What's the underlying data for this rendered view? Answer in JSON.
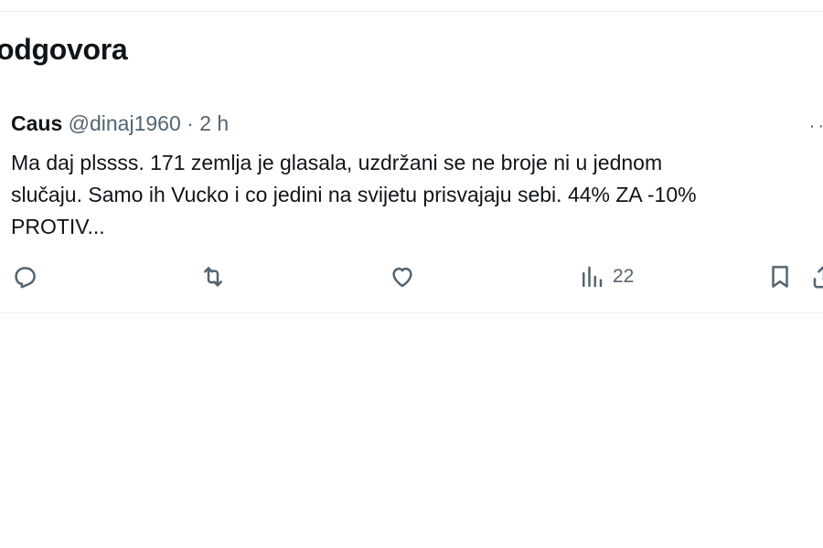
{
  "section": {
    "title": "odgovora"
  },
  "tweet": {
    "author_name": "Caus",
    "author_handle": "@dinaj1960",
    "separator": "·",
    "timestamp": "2 h",
    "more_label": "··",
    "text": "Ma daj plssss. 171 zemlja je glasala, uzdržani se ne broje ni u jednom\nslučaju. Samo ih Vucko i co  jedini na svijetu prisvajaju sebi. 44% ZA -10%\nPROTIV...",
    "actions": {
      "reply_icon": "reply-icon",
      "repost_icon": "repost-icon",
      "like_icon": "heart-icon",
      "views_icon": "views-chart-icon",
      "views_count": "22",
      "bookmark_icon": "bookmark-icon",
      "share_icon": "share-icon"
    }
  },
  "colors": {
    "text_primary": "#0f1419",
    "text_secondary": "#536471",
    "divider": "#eff3f4",
    "background": "#ffffff"
  }
}
